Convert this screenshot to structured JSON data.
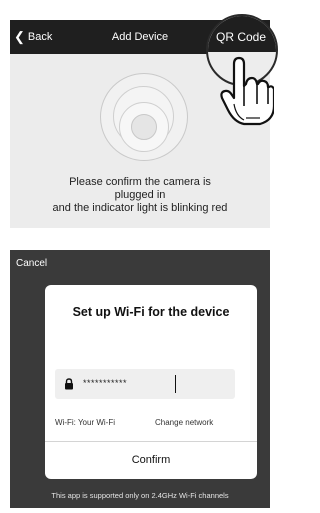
{
  "header": {
    "back_label": "Back",
    "title": "Add Device",
    "qr_label": "QR Code"
  },
  "instructions": {
    "line1": "Please confirm the camera is",
    "line2": "plugged in",
    "line3": "and the indicator light is blinking red"
  },
  "wifi_sheet": {
    "cancel_label": "Cancel",
    "dialog_title": "Set up Wi-Fi for the device",
    "password_value": "***********",
    "wifi_label": "Wi-Fi: Your Wi-Fi",
    "change_network_label": "Change network",
    "confirm_label": "Confirm",
    "footer_note": "This app is supported only on 2.4GHz Wi-Fi channels"
  },
  "icons": {
    "back": "chevron-left-icon",
    "lock": "lock-icon",
    "hand": "pointing-hand-icon",
    "camera": "camera-icon"
  },
  "colors": {
    "topbar": "#1f1f1f",
    "panel_bg": "#ececec",
    "sheet_bg": "#3a3a3a",
    "dialog_bg": "#ffffff"
  }
}
